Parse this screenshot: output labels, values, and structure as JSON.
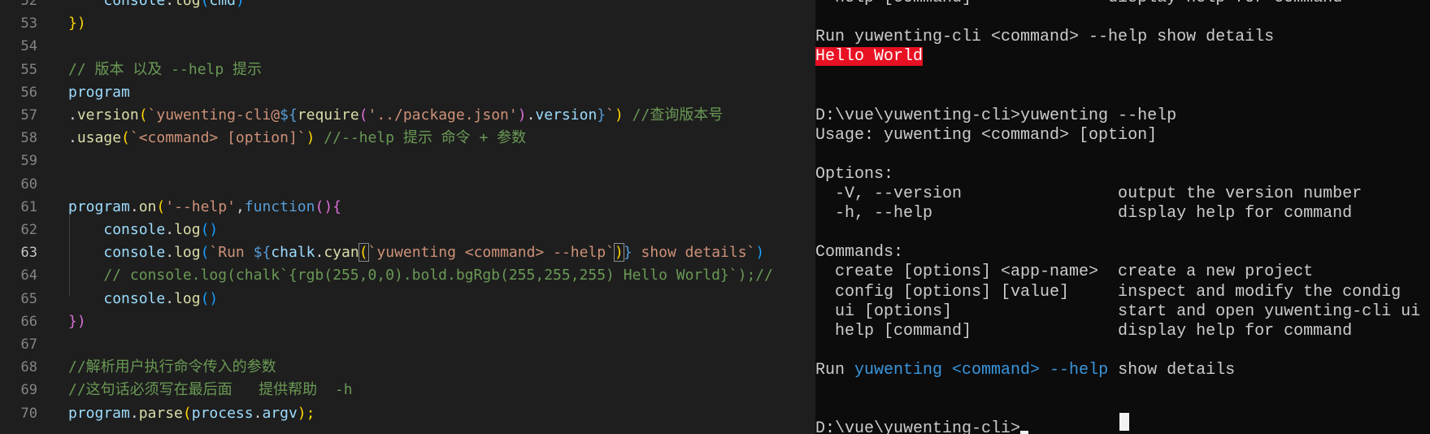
{
  "editor": {
    "lines": [
      {
        "n": "52",
        "tokens": [
          {
            "t": "    ",
            "c": "plain"
          },
          {
            "t": "console",
            "c": "var"
          },
          {
            "t": ".",
            "c": "plain"
          },
          {
            "t": "log",
            "c": "fn"
          },
          {
            "t": "(",
            "c": "paren3"
          },
          {
            "t": "cmd",
            "c": "var"
          },
          {
            "t": ")",
            "c": "paren3"
          }
        ]
      },
      {
        "n": "53",
        "tokens": [
          {
            "t": "})",
            "c": "brace"
          }
        ]
      },
      {
        "n": "54",
        "tokens": []
      },
      {
        "n": "55",
        "tokens": [
          {
            "t": "// 版本 以及 --help 提示",
            "c": "comment"
          }
        ]
      },
      {
        "n": "56",
        "tokens": [
          {
            "t": "program",
            "c": "var"
          }
        ]
      },
      {
        "n": "57",
        "tokens": [
          {
            "t": ".",
            "c": "plain"
          },
          {
            "t": "version",
            "c": "fn"
          },
          {
            "t": "(",
            "c": "brace"
          },
          {
            "t": "`yuwenting-cli@",
            "c": "string"
          },
          {
            "t": "${",
            "c": "interp"
          },
          {
            "t": "require",
            "c": "fn"
          },
          {
            "t": "(",
            "c": "paren2"
          },
          {
            "t": "'../package.json'",
            "c": "string"
          },
          {
            "t": ")",
            "c": "paren2"
          },
          {
            "t": ".",
            "c": "plain"
          },
          {
            "t": "version",
            "c": "var"
          },
          {
            "t": "}",
            "c": "interp"
          },
          {
            "t": "`",
            "c": "string"
          },
          {
            "t": ")",
            "c": "brace"
          },
          {
            "t": " //查询版本号",
            "c": "comment"
          }
        ]
      },
      {
        "n": "58",
        "tokens": [
          {
            "t": ".",
            "c": "plain"
          },
          {
            "t": "usage",
            "c": "fn"
          },
          {
            "t": "(",
            "c": "brace"
          },
          {
            "t": "`<command> [option]`",
            "c": "string"
          },
          {
            "t": ")",
            "c": "brace"
          },
          {
            "t": " //--help 提示 命令 + 参数",
            "c": "comment"
          }
        ]
      },
      {
        "n": "59",
        "tokens": []
      },
      {
        "n": "60",
        "tokens": []
      },
      {
        "n": "61",
        "tokens": [
          {
            "t": "program",
            "c": "var"
          },
          {
            "t": ".",
            "c": "plain"
          },
          {
            "t": "on",
            "c": "fn"
          },
          {
            "t": "(",
            "c": "brace"
          },
          {
            "t": "'--help'",
            "c": "string"
          },
          {
            "t": ",",
            "c": "plain"
          },
          {
            "t": "function",
            "c": "kw"
          },
          {
            "t": "(){",
            "c": "paren2"
          }
        ]
      },
      {
        "n": "62",
        "tokens": [
          {
            "t": "    ",
            "c": "plain"
          },
          {
            "t": "console",
            "c": "var"
          },
          {
            "t": ".",
            "c": "plain"
          },
          {
            "t": "log",
            "c": "fn"
          },
          {
            "t": "()",
            "c": "paren3"
          }
        ]
      },
      {
        "n": "63",
        "current": true,
        "tokens": [
          {
            "t": "    ",
            "c": "plain"
          },
          {
            "t": "console",
            "c": "var"
          },
          {
            "t": ".",
            "c": "plain"
          },
          {
            "t": "log",
            "c": "fn"
          },
          {
            "t": "(",
            "c": "paren3"
          },
          {
            "t": "`Run ",
            "c": "string"
          },
          {
            "t": "${",
            "c": "interp"
          },
          {
            "t": "chalk",
            "c": "var"
          },
          {
            "t": ".",
            "c": "plain"
          },
          {
            "t": "cyan",
            "c": "fn"
          },
          {
            "t": "(",
            "c": "brace-hl"
          },
          {
            "t": "`yuwenting <command> --help`",
            "c": "string"
          },
          {
            "t": ")",
            "c": "brace-hl"
          },
          {
            "t": "}",
            "c": "interp"
          },
          {
            "t": " show details`",
            "c": "string"
          },
          {
            "t": ")",
            "c": "paren3"
          }
        ]
      },
      {
        "n": "64",
        "tokens": [
          {
            "t": "    // console.log(chalk`{rgb(255,0,0).bold.bgRgb(255,255,255) Hello World}`);//",
            "c": "comment"
          }
        ]
      },
      {
        "n": "65",
        "tokens": [
          {
            "t": "    ",
            "c": "plain"
          },
          {
            "t": "console",
            "c": "var"
          },
          {
            "t": ".",
            "c": "plain"
          },
          {
            "t": "log",
            "c": "fn"
          },
          {
            "t": "()",
            "c": "paren3"
          }
        ]
      },
      {
        "n": "66",
        "tokens": [
          {
            "t": "})",
            "c": "paren2"
          }
        ]
      },
      {
        "n": "67",
        "tokens": []
      },
      {
        "n": "68",
        "tokens": [
          {
            "t": "//解析用户执行命令传入的参数",
            "c": "comment"
          }
        ]
      },
      {
        "n": "69",
        "tokens": [
          {
            "t": "//这句话必须写在最后面   提供帮助  -h",
            "c": "comment"
          }
        ]
      },
      {
        "n": "70",
        "tokens": [
          {
            "t": "program",
            "c": "var"
          },
          {
            "t": ".",
            "c": "plain"
          },
          {
            "t": "parse",
            "c": "fn"
          },
          {
            "t": "(",
            "c": "brace"
          },
          {
            "t": "process",
            "c": "var"
          },
          {
            "t": ".",
            "c": "plain"
          },
          {
            "t": "argv",
            "c": "var"
          },
          {
            "t": ");",
            "c": "brace"
          }
        ]
      }
    ]
  },
  "terminal": {
    "lines": [
      [
        {
          "t": "  help [command]              display help for command"
        }
      ],
      [
        {
          "t": ""
        }
      ],
      [
        {
          "t": "Run yuwenting-cli <command> --help show details"
        }
      ],
      [
        {
          "t": "Hello World",
          "s": "red-bg"
        }
      ],
      [
        {
          "t": ""
        }
      ],
      [
        {
          "t": ""
        }
      ],
      [
        {
          "t": "D:\\vue\\yuwenting-cli>yuwenting --help"
        }
      ],
      [
        {
          "t": "Usage: yuwenting <command> [option]"
        }
      ],
      [
        {
          "t": ""
        }
      ],
      [
        {
          "t": "Options:"
        }
      ],
      [
        {
          "t": "  -V, --version                output the version number"
        }
      ],
      [
        {
          "t": "  -h, --help                   display help for command"
        }
      ],
      [
        {
          "t": ""
        }
      ],
      [
        {
          "t": "Commands:"
        }
      ],
      [
        {
          "t": "  create [options] <app-name>  create a new project"
        }
      ],
      [
        {
          "t": "  config [options] [value]     inspect and modify the condig"
        }
      ],
      [
        {
          "t": "  ui [options]                 start and open yuwenting-cli ui"
        }
      ],
      [
        {
          "t": "  help [command]               display help for command"
        }
      ],
      [
        {
          "t": ""
        }
      ],
      [
        {
          "t": "Run "
        },
        {
          "t": "yuwenting <command> --help",
          "s": "cyan"
        },
        {
          "t": " show details"
        }
      ],
      [
        {
          "t": ""
        }
      ],
      [
        {
          "t": ""
        }
      ],
      [
        {
          "t": "D:\\vue\\yuwenting-cli>"
        },
        {
          "t": "",
          "s": "cursor"
        }
      ]
    ]
  }
}
